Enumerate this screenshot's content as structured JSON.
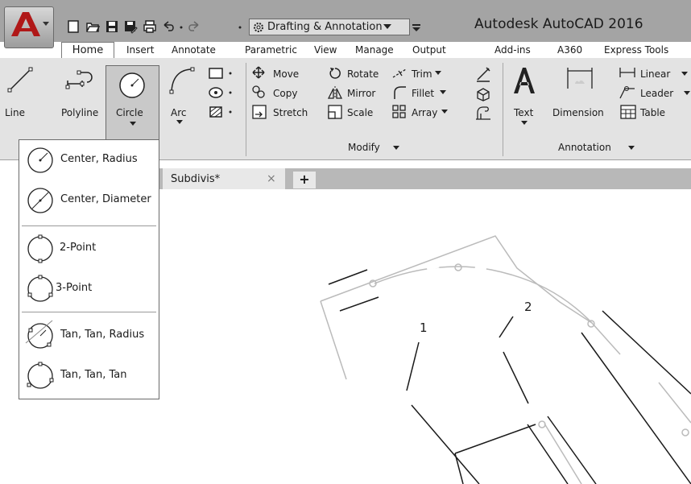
{
  "app": {
    "title": "Autodesk AutoCAD 2016",
    "workspace": "Drafting & Annotation"
  },
  "tabs": [
    "Home",
    "Insert",
    "Annotate",
    "Parametric",
    "View",
    "Manage",
    "Output",
    "Add-ins",
    "A360",
    "Express Tools"
  ],
  "draw_panel": {
    "line": "Line",
    "polyline": "Polyline",
    "circle": "Circle",
    "arc": "Arc"
  },
  "modify_panel": {
    "title": "Modify",
    "move": "Move",
    "copy": "Copy",
    "stretch": "Stretch",
    "rotate": "Rotate",
    "mirror": "Mirror",
    "scale": "Scale",
    "trim": "Trim",
    "fillet": "Fillet",
    "array": "Array"
  },
  "annotation_panel": {
    "title": "Annotation",
    "text": "Text",
    "dimension": "Dimension",
    "linear": "Linear",
    "leader": "Leader",
    "table": "Table"
  },
  "circle_menu": [
    "Center, Radius",
    "Center, Diameter",
    "2-Point",
    "3-Point",
    "Tan, Tan, Radius",
    "Tan, Tan, Tan"
  ],
  "file_tab": {
    "name": "Subdivis*"
  },
  "canvas": {
    "label_1": "1",
    "label_2": "2"
  }
}
